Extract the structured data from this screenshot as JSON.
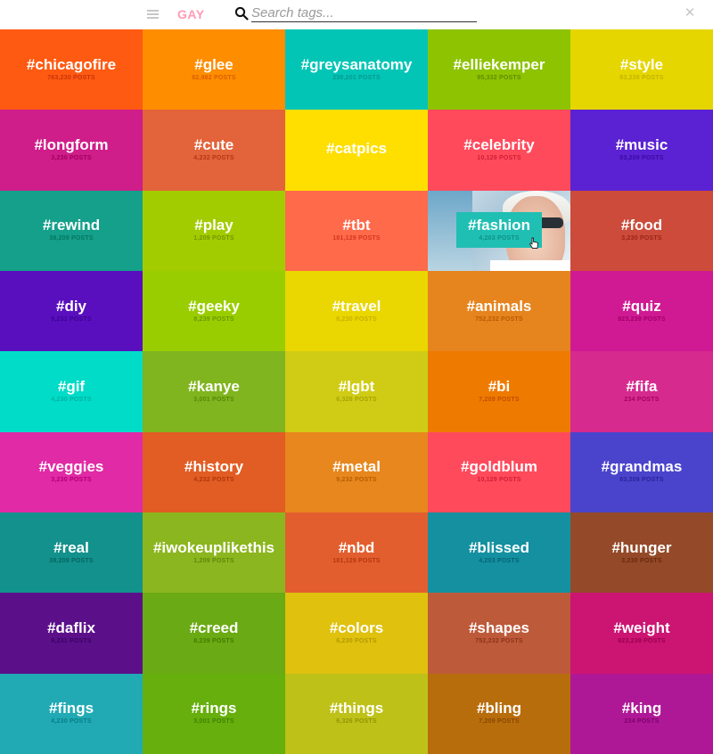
{
  "header": {
    "menu_icon": "hamburger-icon",
    "brand": "GAY",
    "search_icon": "search-icon",
    "search_placeholder": "Search tags...",
    "search_value": "",
    "close_icon": "close-icon"
  },
  "tiles": [
    {
      "tag": "#chicagofire",
      "count": "763,230 POSTS",
      "bg": "#ff5a12",
      "countColor": "#c8330a"
    },
    {
      "tag": "#glee",
      "count": "82,982 POSTS",
      "bg": "#ff8d00",
      "countColor": "#d85f00"
    },
    {
      "tag": "#greysanatomy",
      "count": "238,201 POSTS",
      "bg": "#03c5b6",
      "countColor": "#059a8e"
    },
    {
      "tag": "#elliekemper",
      "count": "95,332 POSTS",
      "bg": "#8dc300",
      "countColor": "#5f8d00"
    },
    {
      "tag": "#style",
      "count": "83,238 POSTS",
      "bg": "#e6d600",
      "countColor": "#c1b300"
    },
    {
      "tag": "#longform",
      "count": "3,230 POSTS",
      "bg": "#cf1d8a",
      "countColor": "#a0005f"
    },
    {
      "tag": "#cute",
      "count": "4,232 POSTS",
      "bg": "#e3633a",
      "countColor": "#b73716"
    },
    {
      "tag": "#catpics",
      "count": "",
      "bg": "#ffdf00",
      "countColor": "#d9b900"
    },
    {
      "tag": "#celebrity",
      "count": "10,129 POSTS",
      "bg": "#ff4a5c",
      "countColor": "#cf1f34"
    },
    {
      "tag": "#music",
      "count": "83,209 POSTS",
      "bg": "#5a22d2",
      "countColor": "#3a0aa3"
    },
    {
      "tag": "#rewind",
      "count": "38,209 POSTS",
      "bg": "#14a08a",
      "countColor": "#077565"
    },
    {
      "tag": "#play",
      "count": "1,209 POSTS",
      "bg": "#a3cc00",
      "countColor": "#749700"
    },
    {
      "tag": "#tbt",
      "count": "181,129 POSTS",
      "bg": "#ff6a4a",
      "countColor": "#d5361f"
    },
    {
      "tag": "#fashion",
      "count": "4,203 POSTS",
      "bg": "#20bfb3",
      "countColor": "#0f9187",
      "featured": true
    },
    {
      "tag": "#food",
      "count": "3,230 POSTS",
      "bg": "#cc4b3b",
      "countColor": "#9c2518"
    },
    {
      "tag": "#diy",
      "count": "9,231 POSTS",
      "bg": "#5a0fbf",
      "countColor": "#3b0390"
    },
    {
      "tag": "#geeky",
      "count": "8,239 POSTS",
      "bg": "#9acd00",
      "countColor": "#6b9900"
    },
    {
      "tag": "#travel",
      "count": "6,230 POSTS",
      "bg": "#ead600",
      "countColor": "#c6b200"
    },
    {
      "tag": "#animals",
      "count": "752,232 POSTS",
      "bg": "#e6841e",
      "countColor": "#b85b02"
    },
    {
      "tag": "#quiz",
      "count": "923,239 POSTS",
      "bg": "#d01a93",
      "countColor": "#a0006a"
    },
    {
      "tag": "#gif",
      "count": "4,230 POSTS",
      "bg": "#00dcc8",
      "countColor": "#00b2a2"
    },
    {
      "tag": "#kanye",
      "count": "3,001 POSTS",
      "bg": "#80b51f",
      "countColor": "#588807"
    },
    {
      "tag": "#lgbt",
      "count": "6,326 POSTS",
      "bg": "#d0cc16",
      "countColor": "#a6a300"
    },
    {
      "tag": "#bi",
      "count": "7,209 POSTS",
      "bg": "#ef7a00",
      "countColor": "#c04f00"
    },
    {
      "tag": "#fifa",
      "count": "234 POSTS",
      "bg": "#d62a8e",
      "countColor": "#a50062"
    },
    {
      "tag": "#veggies",
      "count": "3,230 POSTS",
      "bg": "#e12aa5",
      "countColor": "#b30078"
    },
    {
      "tag": "#history",
      "count": "4,232 POSTS",
      "bg": "#e25d24",
      "countColor": "#b2360a"
    },
    {
      "tag": "#metal",
      "count": "9,232 POSTS",
      "bg": "#e7871d",
      "countColor": "#b85d00"
    },
    {
      "tag": "#goldblum",
      "count": "10,129 POSTS",
      "bg": "#ff4a5c",
      "countColor": "#cf1f34"
    },
    {
      "tag": "#grandmas",
      "count": "83,209 POSTS",
      "bg": "#4a44cc",
      "countColor": "#2a239c"
    },
    {
      "tag": "#real",
      "count": "38,209 POSTS",
      "bg": "#13918c",
      "countColor": "#056662"
    },
    {
      "tag": "#iwokeuplikethis",
      "count": "1,209 POSTS",
      "bg": "#8cb61f",
      "countColor": "#5f8906"
    },
    {
      "tag": "#nbd",
      "count": "181,129 POSTS",
      "bg": "#e35e2e",
      "countColor": "#b43610"
    },
    {
      "tag": "#blissed",
      "count": "4,203 POSTS",
      "bg": "#1490a0",
      "countColor": "#056573"
    },
    {
      "tag": "#hunger",
      "count": "3,230 POSTS",
      "bg": "#944a28",
      "countColor": "#6a2a0d"
    },
    {
      "tag": "#daflix",
      "count": "9,231 POSTS",
      "bg": "#5b108a",
      "countColor": "#3b0161"
    },
    {
      "tag": "#creed",
      "count": "8,239 POSTS",
      "bg": "#6aaa14",
      "countColor": "#447d00"
    },
    {
      "tag": "#colors",
      "count": "6,230 POSTS",
      "bg": "#dfc10e",
      "countColor": "#b59800"
    },
    {
      "tag": "#shapes",
      "count": "752,232 POSTS",
      "bg": "#bd5a3a",
      "countColor": "#8e3518"
    },
    {
      "tag": "#weight",
      "count": "923,239 POSTS",
      "bg": "#cc1472",
      "countColor": "#99004f"
    },
    {
      "tag": "#fings",
      "count": "4,230 POSTS",
      "bg": "#21aab4",
      "countColor": "#067d87"
    },
    {
      "tag": "#rings",
      "count": "3,001 POSTS",
      "bg": "#66af0d",
      "countColor": "#3f8200"
    },
    {
      "tag": "#things",
      "count": "6,326 POSTS",
      "bg": "#bec118",
      "countColor": "#929500"
    },
    {
      "tag": "#bling",
      "count": "7,209 POSTS",
      "bg": "#b86d0c",
      "countColor": "#894700"
    },
    {
      "tag": "#king",
      "count": "234 POSTS",
      "bg": "#ae1896",
      "countColor": "#7f006a"
    }
  ]
}
